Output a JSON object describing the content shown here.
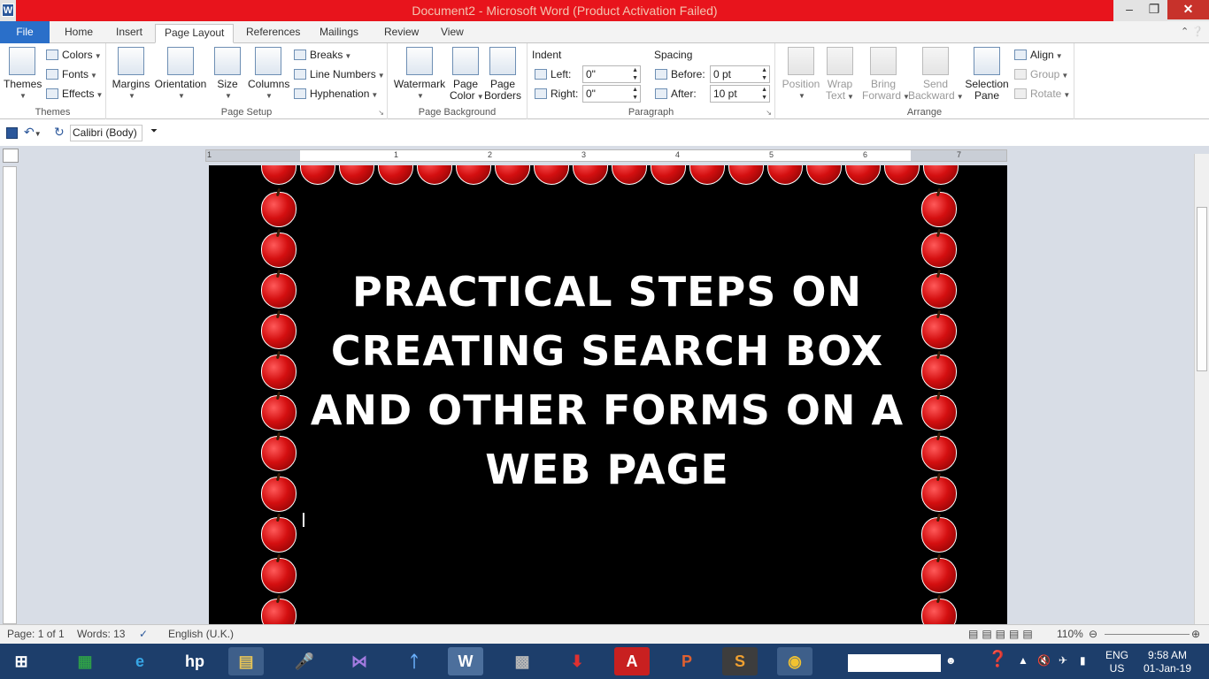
{
  "window": {
    "title": "Document2 - Microsoft Word (Product Activation Failed)",
    "app_letter": "W"
  },
  "tabs": [
    "Home",
    "Insert",
    "Page Layout",
    "References",
    "Mailings",
    "Review",
    "View"
  ],
  "file_tab": "File",
  "ribbon": {
    "themes": {
      "big": "Themes",
      "colors": "Colors",
      "fonts": "Fonts",
      "effects": "Effects",
      "label": "Themes"
    },
    "page_setup": {
      "margins": "Margins",
      "orientation": "Orientation",
      "size": "Size",
      "columns": "Columns",
      "breaks": "Breaks",
      "line_numbers": "Line Numbers",
      "hyphenation": "Hyphenation",
      "label": "Page Setup"
    },
    "page_background": {
      "watermark": "Watermark",
      "page_color_1": "Page",
      "page_color_2": "Color",
      "page_borders_1": "Page",
      "page_borders_2": "Borders",
      "label": "Page Background"
    },
    "paragraph": {
      "indent": "Indent",
      "left": "Left:",
      "left_val": "0\"",
      "right": "Right:",
      "right_val": "0\"",
      "spacing": "Spacing",
      "before": "Before:",
      "before_val": "0 pt",
      "after": "After:",
      "after_val": "10 pt",
      "label": "Paragraph"
    },
    "arrange": {
      "position": "Position",
      "wrap_1": "Wrap",
      "wrap_2": "Text",
      "bring_1": "Bring",
      "bring_2": "Forward",
      "send_1": "Send",
      "send_2": "Backward",
      "sel_1": "Selection",
      "sel_2": "Pane",
      "align": "Align",
      "group": "Group",
      "rotate": "Rotate",
      "label": "Arrange"
    }
  },
  "qat": {
    "font": "Calibri (Body)"
  },
  "ruler_numbers": [
    "1",
    "1",
    "2",
    "3",
    "4",
    "5",
    "6",
    "7"
  ],
  "document": {
    "heading": "PRACTICAL STEPS ON CREATING SEARCH BOX AND OTHER FORMS ON A WEB PAGE"
  },
  "status": {
    "page": "Page: 1 of 1",
    "words": "Words: 13",
    "language": "English (U.K.)",
    "zoom": "110%"
  },
  "taskbar": {
    "lang_1": "ENG",
    "lang_2": "US",
    "time": "9:58 AM",
    "date": "01-Jan-19"
  }
}
